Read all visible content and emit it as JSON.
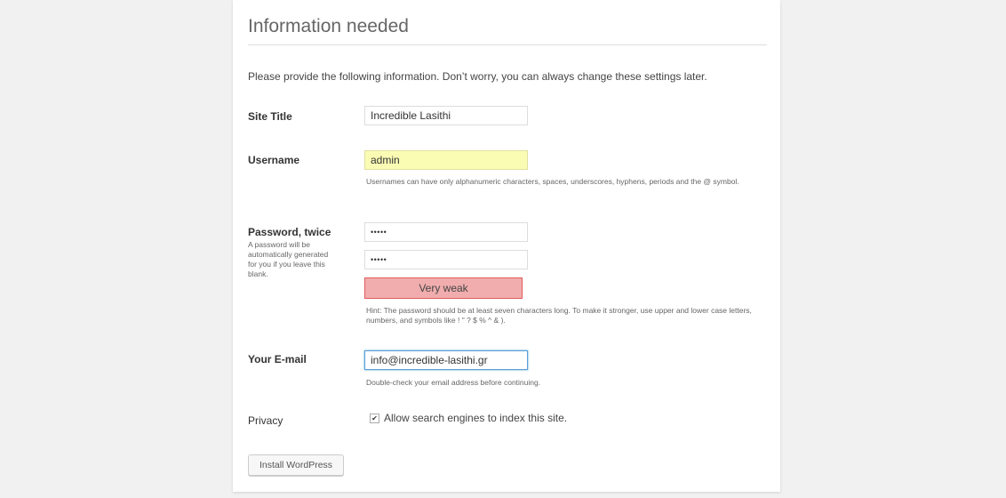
{
  "form": {
    "heading": "Information needed",
    "intro": "Please provide the following information. Don’t worry, you can always change these settings later.",
    "site_title": {
      "label": "Site Title",
      "value": "Incredible Lasithi"
    },
    "username": {
      "label": "Username",
      "value": "admin",
      "help": "Usernames can have only alphanumeric characters, spaces, underscores, hyphens, periods and the @ symbol."
    },
    "password": {
      "label": "Password, twice",
      "description": "A password will be automatically generated for you if you leave this blank.",
      "value1": "•••••",
      "value2": "•••••",
      "strength": "Very weak",
      "hint": "Hint: The password should be at least seven characters long. To make it stronger, use upper and lower case letters, numbers, and symbols like ! \" ? $ % ^ & )."
    },
    "email": {
      "label": "Your E-mail",
      "value": "info@incredible-lasithi.gr",
      "help": "Double-check your email address before continuing."
    },
    "privacy": {
      "label": "Privacy",
      "checkbox_label": "Allow search engines to index this site.",
      "checked": true
    },
    "submit_label": "Install WordPress"
  },
  "colors": {
    "background": "#f1f1f1",
    "strength_weak_bg": "#f1adad",
    "strength_weak_border": "#e35b5b",
    "autofill_yellow": "#fafcb4",
    "focus_blue": "#5b9dd9"
  }
}
